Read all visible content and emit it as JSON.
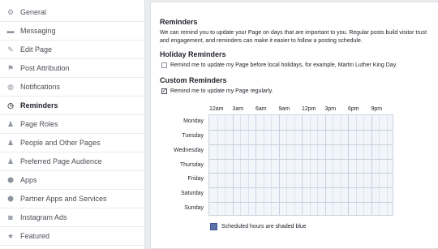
{
  "sidebar": {
    "items": [
      {
        "label": "General",
        "icon": "gear-icon",
        "glyph": "⚙",
        "active": false
      },
      {
        "label": "Messaging",
        "icon": "messaging-icon",
        "glyph": "▬",
        "active": false
      },
      {
        "label": "Edit Page",
        "icon": "pencil-icon",
        "glyph": "✎",
        "active": false
      },
      {
        "label": "Post Attribution",
        "icon": "flag-icon",
        "glyph": "⚑",
        "active": false
      },
      {
        "label": "Notifications",
        "icon": "globe-icon",
        "glyph": "◍",
        "active": false
      },
      {
        "label": "Reminders",
        "icon": "clock-icon",
        "glyph": "◷",
        "active": true
      },
      {
        "label": "Page Roles",
        "icon": "person-icon",
        "glyph": "♟",
        "active": false
      },
      {
        "label": "People and Other Pages",
        "icon": "people-icon",
        "glyph": "♟",
        "active": false
      },
      {
        "label": "Preferred Page Audience",
        "icon": "audience-icon",
        "glyph": "♟",
        "active": false
      },
      {
        "label": "Apps",
        "icon": "apps-icon",
        "glyph": "⬢",
        "active": false
      },
      {
        "label": "Partner Apps and Services",
        "icon": "partner-apps-icon",
        "glyph": "⬢",
        "active": false
      },
      {
        "label": "Instagram Ads",
        "icon": "instagram-icon",
        "glyph": "◙",
        "active": false
      },
      {
        "label": "Featured",
        "icon": "star-icon",
        "glyph": "★",
        "active": false
      }
    ]
  },
  "main": {
    "title": "Reminders",
    "description": "We can remind you to update your Page on days that are important to you. Regular posts build visitor trust and engagement, and reminders can make it easier to follow a posting schedule.",
    "holiday": {
      "heading": "Holiday Reminders",
      "checkbox_label": "Remind me to update my Page before local holidays, for example, Martin Luther King Day.",
      "checked": false
    },
    "custom": {
      "heading": "Custom Reminders",
      "checkbox_label": "Remind me to update my Page regularly.",
      "checked": true
    },
    "schedule": {
      "times": [
        "12am",
        "3am",
        "6am",
        "9am",
        "12pm",
        "3pm",
        "6pm",
        "9pm"
      ],
      "days": [
        "Monday",
        "Tuesday",
        "Wednesday",
        "Thursday",
        "Friday",
        "Saturday",
        "Sunday"
      ],
      "legend": "Scheduled hours are shaded blue",
      "legend_color": "#5b73a8",
      "grid_color": "#f2f6fb"
    }
  }
}
